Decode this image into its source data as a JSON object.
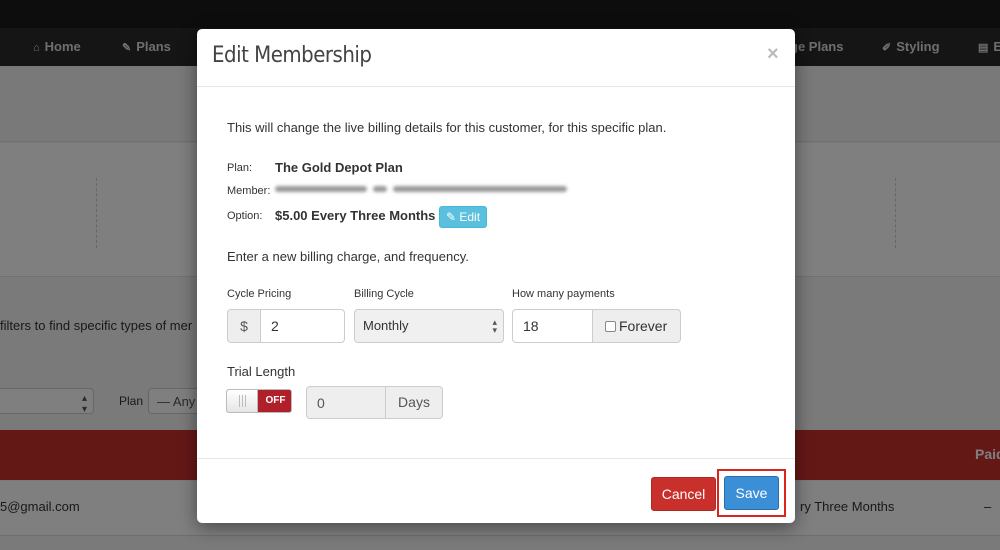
{
  "nav": {
    "items": [
      {
        "icon": "home-icon",
        "glyph": "⌂",
        "label": "Home"
      },
      {
        "icon": "edit-icon",
        "glyph": "✎",
        "label": "Plans"
      },
      {
        "icon": "",
        "glyph": "",
        "label": "ge Plans"
      },
      {
        "icon": "brush-icon",
        "glyph": "✐",
        "label": "Styling"
      },
      {
        "icon": "file-icon",
        "glyph": "▤",
        "label": "E"
      }
    ]
  },
  "background": {
    "filter_text": "filters to find specific types of mer",
    "plan_label": "Plan",
    "plan_select": "— Any",
    "paid_header": "Paid",
    "row_email": "5@gmail.com",
    "row_option": "ry Three Months",
    "row_dash": "–"
  },
  "modal": {
    "title": "Edit Membership",
    "close": "×",
    "intro": "This will change the live billing details for this customer, for this specific plan.",
    "plan_label": "Plan:",
    "plan_value": "The Gold Depot Plan",
    "member_label": "Member:",
    "option_label": "Option:",
    "option_value": "$5.00 Every Three Months",
    "edit_button": "Edit",
    "subintro": "Enter a new billing charge, and frequency.",
    "cycle_pricing_label": "Cycle Pricing",
    "currency": "$",
    "cycle_pricing_value": "2",
    "billing_cycle_label": "Billing Cycle",
    "billing_cycle_value": "Monthly",
    "payments_label": "How many payments",
    "payments_value": "18",
    "forever_label": "Forever",
    "trial_label": "Trial Length",
    "toggle_state": "OFF",
    "trial_value": "0",
    "trial_unit": "Days",
    "cancel_button": "Cancel",
    "save_button": "Save"
  },
  "colors": {
    "navbar": "#2b2b2b",
    "red_bar": "#c9302c",
    "save": "#3a8fd6",
    "cancel": "#c9302c",
    "edit": "#5bc0de",
    "highlight": "#d9261c"
  }
}
